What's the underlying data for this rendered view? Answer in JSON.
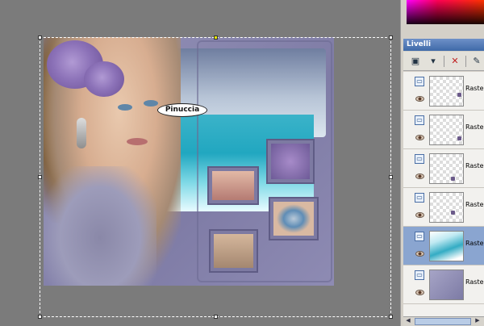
{
  "artwork": {
    "name_tag": "Pinuccia"
  },
  "panel": {
    "title": "Livelli",
    "toolbar": {
      "new_layer_icon": "new-raster-layer-icon",
      "delete_icon": "delete-layer-icon",
      "properties_icon": "layer-properties-icon"
    },
    "layers": [
      {
        "name": "Raster",
        "thumb": "transparent",
        "active": false
      },
      {
        "name": "Raster",
        "thumb": "transparent",
        "active": false
      },
      {
        "name": "Raster",
        "thumb": "transparent",
        "active": false
      },
      {
        "name": "Raster",
        "thumb": "transparent",
        "active": false
      },
      {
        "name": "Raster",
        "thumb": "waterfall",
        "active": true
      },
      {
        "name": "Raster",
        "thumb": "lilac",
        "active": false
      }
    ]
  }
}
